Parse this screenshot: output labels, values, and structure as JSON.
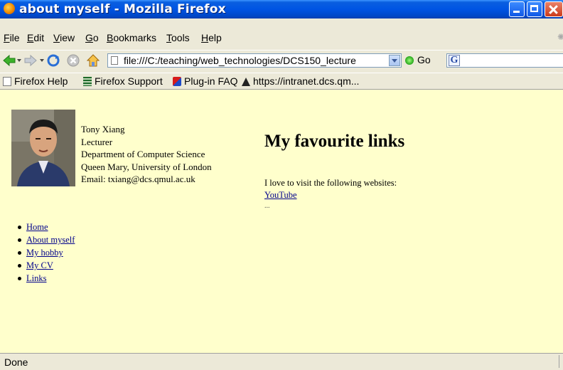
{
  "window": {
    "title": "about myself - Mozilla Firefox"
  },
  "menu": {
    "items": [
      "File",
      "Edit",
      "View",
      "Go",
      "Bookmarks",
      "Tools",
      "Help"
    ]
  },
  "navbar": {
    "url": "file:///C:/teaching/web_technologies/DCS150_lecture",
    "go_label": "Go",
    "search_value": ""
  },
  "bookmarks": [
    {
      "label": "Firefox Help",
      "icon": "page-icon"
    },
    {
      "label": "Firefox Support",
      "icon": "support-icon"
    },
    {
      "label": "Plug-in FAQ",
      "icon": "plugin-icon"
    },
    {
      "label": "https://intranet.dcs.qm...",
      "icon": "intranet-icon"
    }
  ],
  "page": {
    "profile": {
      "name": "Tony Xiang",
      "role": "Lecturer",
      "department": "Department of Computer Science",
      "university": "Queen Mary, University of London",
      "email": "Email: txiang@dcs.qmul.ac.uk"
    },
    "nav_links": [
      "Home",
      "About myself",
      "My hobby",
      "My CV",
      "Links"
    ],
    "heading": "My favourite links",
    "intro": "I love to visit the following websites:",
    "link": "YouTube",
    "ellipsis": "..."
  },
  "status": {
    "text": "Done"
  },
  "colors": {
    "page_background": "#ffffcc",
    "link": "#00008b",
    "titlebar": "#0054e3",
    "chrome": "#ece9d8"
  }
}
